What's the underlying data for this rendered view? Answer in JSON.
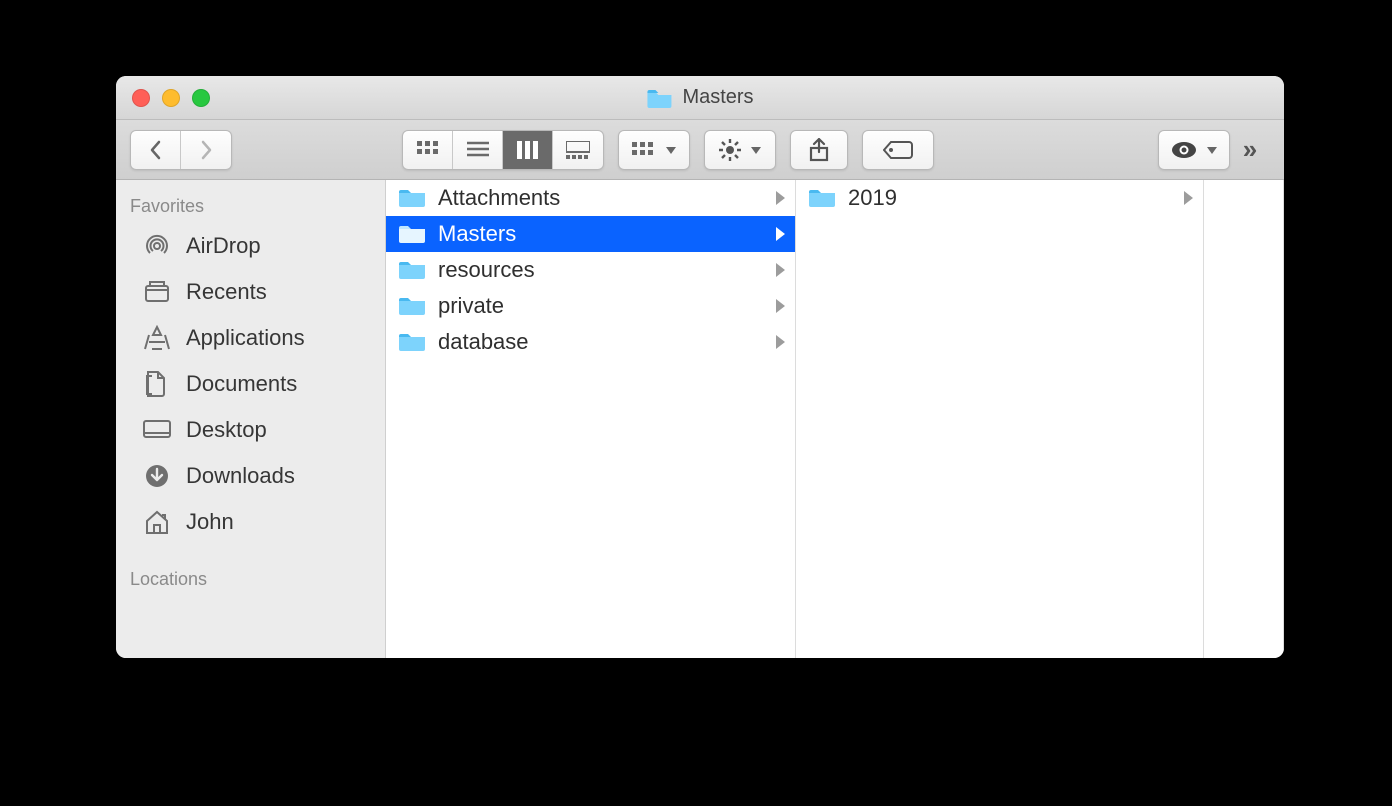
{
  "window": {
    "title": "Masters"
  },
  "sidebar": {
    "headers": {
      "favorites": "Favorites",
      "locations": "Locations"
    },
    "items": [
      {
        "label": "AirDrop",
        "icon": "airdrop-icon"
      },
      {
        "label": "Recents",
        "icon": "recents-icon"
      },
      {
        "label": "Applications",
        "icon": "applications-icon"
      },
      {
        "label": "Documents",
        "icon": "documents-icon"
      },
      {
        "label": "Desktop",
        "icon": "desktop-icon"
      },
      {
        "label": "Downloads",
        "icon": "downloads-icon"
      },
      {
        "label": "John",
        "icon": "home-icon"
      }
    ]
  },
  "columns": [
    {
      "items": [
        {
          "label": "Attachments",
          "hasChildren": true,
          "selected": false
        },
        {
          "label": "Masters",
          "hasChildren": true,
          "selected": true
        },
        {
          "label": "resources",
          "hasChildren": true,
          "selected": false
        },
        {
          "label": "private",
          "hasChildren": true,
          "selected": false
        },
        {
          "label": "database",
          "hasChildren": true,
          "selected": false
        }
      ]
    },
    {
      "items": [
        {
          "label": "2019",
          "hasChildren": true,
          "selected": false
        }
      ]
    },
    {
      "items": []
    }
  ],
  "colors": {
    "folder_light": "#7dd3fc",
    "folder_dark": "#49b9f0",
    "selection": "#0a63ff"
  }
}
